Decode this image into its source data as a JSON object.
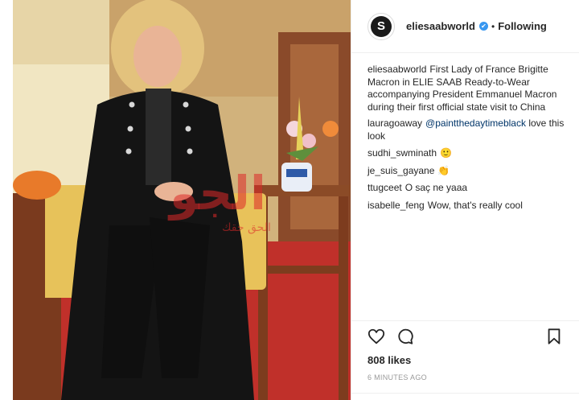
{
  "post": {
    "account": "eliesaabworld",
    "verified_mark": "✔",
    "separator": "•",
    "follow_status": "Following",
    "avatar_letter": "S",
    "likes": "808 likes",
    "time_ago": "6 MINUTES AGO"
  },
  "caption": {
    "user": "eliesaabworld",
    "text": "First Lady of France Brigitte Macron in ELIE SAAB Ready-to-Wear accompanying President Emmanuel Macron during their first official state visit to China"
  },
  "comments": [
    {
      "user": "lauragoaway",
      "mention": "@paintthedaytimeblack",
      "text": "love this look"
    },
    {
      "user": "sudhi_swminath",
      "mention": "",
      "text": "🙂"
    },
    {
      "user": "je_suis_gayane",
      "mention": "",
      "text": "👏"
    },
    {
      "user": "ttugceet",
      "mention": "",
      "text": "O saç ne yaaa"
    },
    {
      "user": "isabelle_feng",
      "mention": "",
      "text": "Wow, that's really cool"
    }
  ],
  "watermark": {
    "main": "الجو",
    "sub": "الحق حقك"
  },
  "icons": {
    "like": "heart-icon",
    "comment": "comment-icon",
    "save": "bookmark-icon"
  }
}
